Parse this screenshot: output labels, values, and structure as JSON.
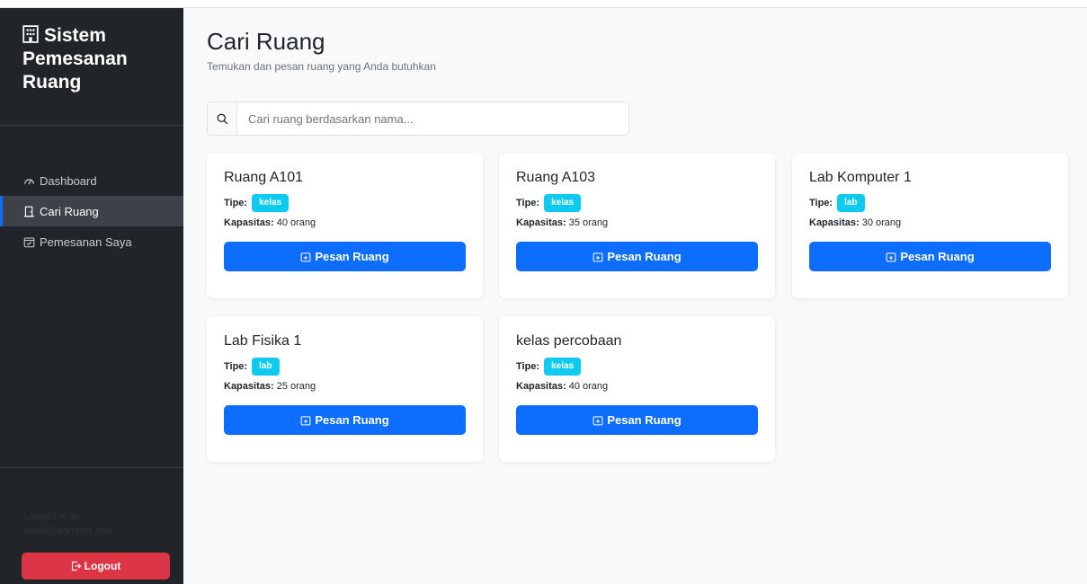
{
  "sidebar": {
    "brand": "Sistem Pemesanan Ruang",
    "nav": [
      {
        "label": "Dashboard",
        "icon": "speedometer-icon"
      },
      {
        "label": "Cari Ruang",
        "icon": "door-icon",
        "active": true
      },
      {
        "label": "Pemesanan Saya",
        "icon": "calendar-check-icon"
      }
    ],
    "user_name": "Logged in as",
    "user_email": "siswa@kampus.edu",
    "logout_label": "Logout"
  },
  "main": {
    "title": "Cari Ruang",
    "subtitle": "Temukan dan pesan ruang yang Anda butuhkan",
    "search": {
      "placeholder": "Cari ruang berdasarkan nama..."
    }
  },
  "labels": {
    "type": "Tipe:",
    "capacity": "Kapasitas:",
    "book": "Pesan Ruang"
  },
  "rooms": [
    {
      "name": "Ruang A101",
      "type": "kelas",
      "capacity": "40 orang"
    },
    {
      "name": "Ruang A103",
      "type": "kelas",
      "capacity": "35 orang"
    },
    {
      "name": "Lab Komputer 1",
      "type": "lab",
      "capacity": "30 orang"
    },
    {
      "name": "Lab Fisika 1",
      "type": "lab",
      "capacity": "25 orang"
    },
    {
      "name": "kelas percobaan",
      "type": "kelas",
      "capacity": "40 orang"
    }
  ],
  "colors": {
    "primary": "#0d6efd",
    "info": "#0dcaf0",
    "danger": "#dc3545",
    "sidebar": "#212529"
  }
}
